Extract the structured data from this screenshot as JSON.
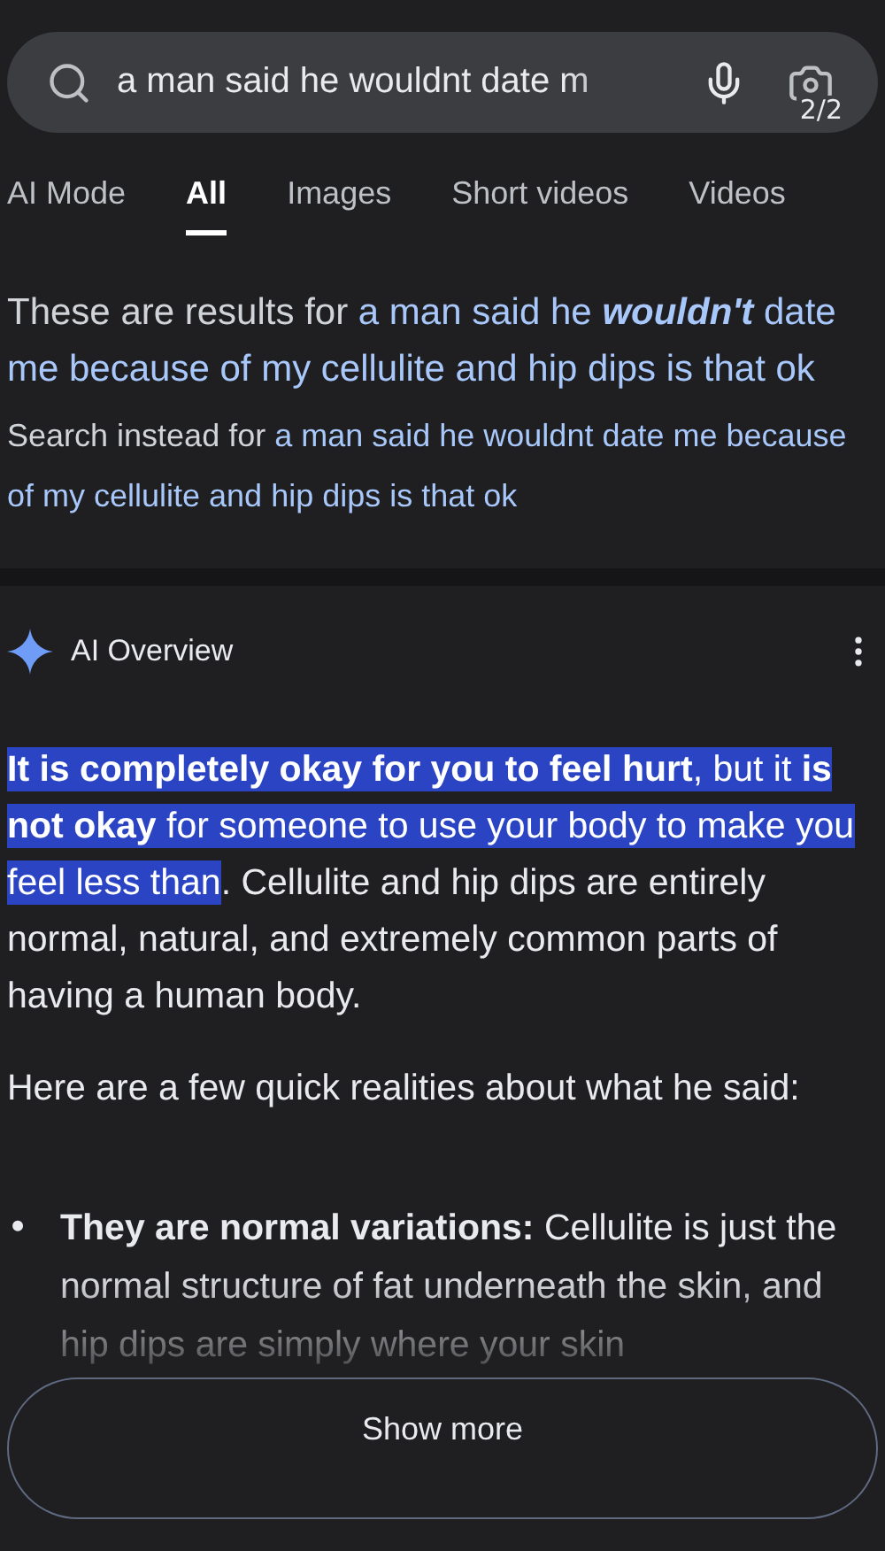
{
  "search": {
    "value": "a man said he wouldnt date m",
    "counter": "2/2"
  },
  "tabs": [
    {
      "label": "AI Mode",
      "selected": false
    },
    {
      "label": "All",
      "selected": true
    },
    {
      "label": "Images",
      "selected": false
    },
    {
      "label": "Short videos",
      "selected": false
    },
    {
      "label": "Videos",
      "selected": false
    }
  ],
  "correction": {
    "prefix": "These are results for ",
    "query_before": "a man said he ",
    "query_emph": "wouldn't",
    "query_after": " date me because of my cellulite and hip dips is that ok",
    "alt_prefix": "Search instead for ",
    "alt_query": "a man said he wouldnt date me because of my cellulite and hip dips is that ok"
  },
  "overview": {
    "title": "AI Overview",
    "intro": {
      "highlighted": "**It is completely okay for you to feel hurt**, but it **is not okay** for someone to use your body to make you feel less than",
      "text": ". Cellulite and hip dips are entirely normal, natural, and extremely common parts of having a human body."
    },
    "lead": "Here are a few quick realities about what he said:",
    "bullets": [
      {
        "marker": "•",
        "heading": "They are normal variations:",
        "text": "Cellulite is just the normal structure of fat underneath the skin, and hip dips are simply where your skin"
      }
    ],
    "show_more": "Show more"
  }
}
